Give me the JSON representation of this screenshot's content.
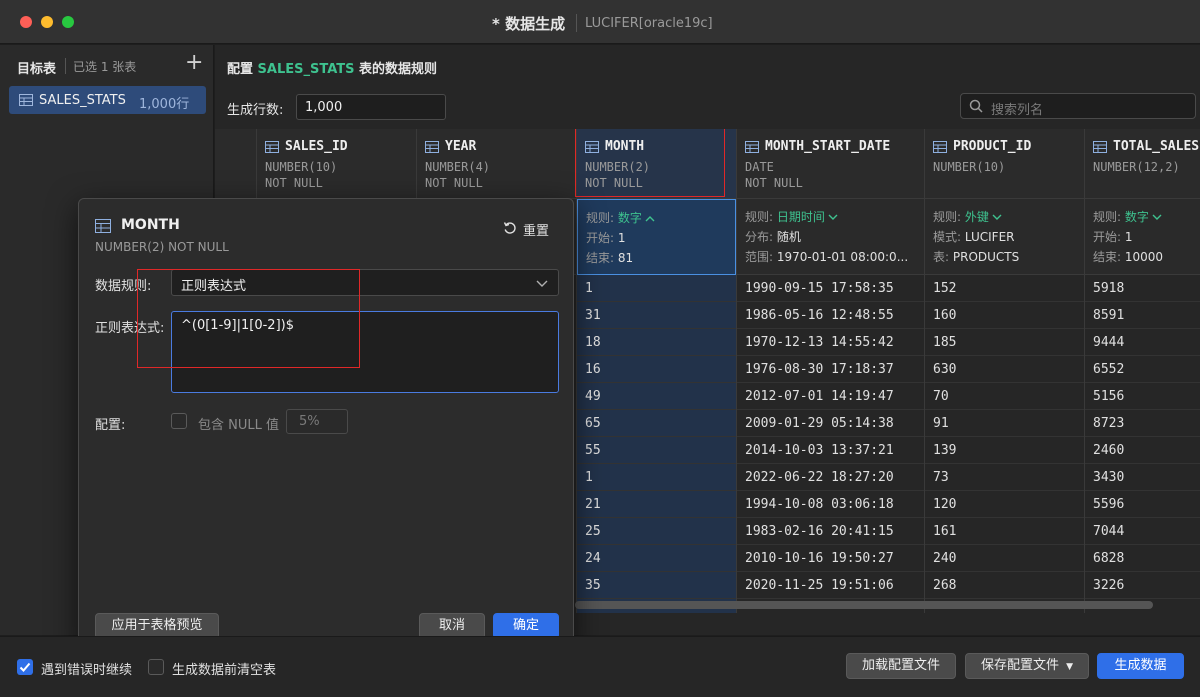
{
  "window": {
    "title": "* 数据生成",
    "connection": "LUCIFER[oracle19c]"
  },
  "sidebar": {
    "title": "目标表",
    "selected_count": "已选 1 张表",
    "add_icon": "plus-icon",
    "items": [
      {
        "name": "SALES_STATS",
        "rows": "1,000行"
      }
    ]
  },
  "main": {
    "config_prefix": "配置",
    "config_table": "SALES_STATS",
    "config_suffix": "表的数据规则",
    "rows_label": "生成行数:",
    "rows_value": "1,000",
    "search_placeholder": "搜索列名"
  },
  "columns": [
    {
      "name": "SALES_ID",
      "type": "NUMBER(10)",
      "nullable": "NOT NULL",
      "rule": [],
      "cells": []
    },
    {
      "name": "YEAR",
      "type": "NUMBER(4)",
      "nullable": "NOT NULL",
      "rule": [],
      "cells": []
    },
    {
      "name": "MONTH",
      "type": "NUMBER(2)",
      "nullable": "NOT NULL",
      "rule": [
        {
          "key": "规则:",
          "value": "数字",
          "accent": true,
          "chevron": "up"
        },
        {
          "key": "开始:",
          "value": "1"
        },
        {
          "key": "结束:",
          "value": "81"
        }
      ],
      "cells": [
        "1",
        "31",
        "18",
        "16",
        "49",
        "65",
        "55",
        "1",
        "21",
        "25",
        "24",
        "35"
      ]
    },
    {
      "name": "MONTH_START_DATE",
      "type": "DATE",
      "nullable": "NOT NULL",
      "rule": [
        {
          "key": "规则:",
          "value": "日期时间",
          "accent": true,
          "chevron": "down"
        },
        {
          "key": "分布:",
          "value": "随机"
        },
        {
          "key": "范围:",
          "value": "1970-01-01 08:00:0..."
        }
      ],
      "cells": [
        "1990-09-15 17:58:35",
        "1986-05-16 12:48:55",
        "1970-12-13 14:55:42",
        "1976-08-30 17:18:37",
        "2012-07-01 14:19:47",
        "2009-01-29 05:14:38",
        "2014-10-03 13:37:21",
        "2022-06-22 18:27:20",
        "1994-10-08 03:06:18",
        "1983-02-16 20:41:15",
        "2010-10-16 19:50:27",
        "2020-11-25 19:51:06"
      ]
    },
    {
      "name": "PRODUCT_ID",
      "type": "NUMBER(10)",
      "nullable": "",
      "rule": [
        {
          "key": "规则:",
          "value": "外键",
          "accent": true,
          "chevron": "down"
        },
        {
          "key": "模式:",
          "value": "LUCIFER"
        },
        {
          "key": "表:",
          "value": "PRODUCTS"
        }
      ],
      "cells": [
        "152",
        "160",
        "185",
        "630",
        "70",
        "91",
        "139",
        "73",
        "120",
        "161",
        "240",
        "268"
      ]
    },
    {
      "name": "TOTAL_SALES",
      "type": "NUMBER(12,2)",
      "nullable": "",
      "rule": [
        {
          "key": "规则:",
          "value": "数字",
          "accent": true,
          "chevron": "down"
        },
        {
          "key": "开始:",
          "value": "1"
        },
        {
          "key": "结束:",
          "value": "10000"
        }
      ],
      "cells": [
        "5918",
        "8591",
        "9444",
        "6552",
        "5156",
        "8723",
        "2460",
        "3430",
        "5596",
        "7044",
        "6828",
        "3226"
      ]
    }
  ],
  "dialog": {
    "title": "MONTH",
    "subtitle": "NUMBER(2) NOT NULL",
    "reset_label": "重置",
    "rule_label": "数据规则:",
    "rule_value": "正则表达式",
    "regex_label": "正则表达式:",
    "regex_value": "^(0[1-9]|1[0-2])$",
    "config_label": "配置:",
    "include_null_label": "包含 NULL 值",
    "null_percent": "5%",
    "apply_button": "应用于表格预览",
    "cancel_button": "取消",
    "ok_button": "确定"
  },
  "footer": {
    "continue_on_error": "遇到错误时继续",
    "continue_on_error_checked": true,
    "clear_before": "生成数据前清空表",
    "clear_before_checked": false,
    "load_config": "加载配置文件",
    "save_config": "保存配置文件",
    "generate": "生成数据"
  },
  "colors": {
    "accent_green": "#3ec28f",
    "primary_blue": "#2f6fe8",
    "highlight_red": "#e02828"
  }
}
